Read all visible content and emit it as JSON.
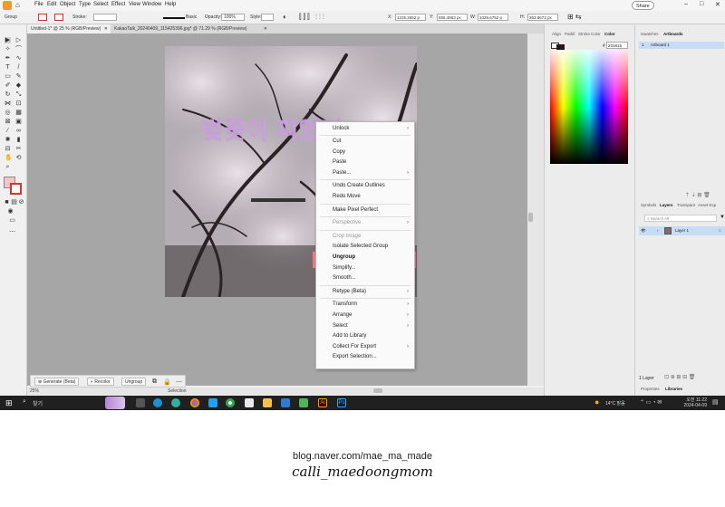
{
  "menu": [
    "File",
    "Edit",
    "Object",
    "Type",
    "Select",
    "Effect",
    "View",
    "Window",
    "Help"
  ],
  "share_button": "Share",
  "control_bar": {
    "selection_label": "Group",
    "stroke_label": "Stroke:",
    "brush_label": "Basic",
    "opacity_label": "Opacity:",
    "opacity_value": "100%",
    "style_label": "Style:",
    "x_value": "1225.2652 p",
    "y_value": "555.4863 px",
    "w_value": "1029.6752 p",
    "h_value": "353.8673 px"
  },
  "doc_tabs": [
    {
      "label": "Untitled-1* @ 25 % (RGB/Preview)",
      "active": true
    },
    {
      "label": "KakaoTalk_20240409_115425396.jpg* @ 71.29 % (RGB/Preview)",
      "active": false
    }
  ],
  "artwork": {
    "text": "벚꽃이 피었다"
  },
  "context_menu": [
    {
      "label": "Unlock",
      "arrow": true,
      "disabled": false
    },
    {
      "sep": true
    },
    {
      "label": "Cut",
      "arrow": false,
      "disabled": false
    },
    {
      "label": "Copy",
      "arrow": false,
      "disabled": false
    },
    {
      "label": "Paste",
      "arrow": false,
      "disabled": false
    },
    {
      "label": "Paste...",
      "arrow": true,
      "disabled": false
    },
    {
      "sep": true
    },
    {
      "label": "Undo Create Outlines",
      "arrow": false,
      "disabled": false
    },
    {
      "label": "Redo Move",
      "arrow": false,
      "disabled": false
    },
    {
      "sep": true
    },
    {
      "label": "Make Pixel Perfect",
      "arrow": false,
      "disabled": false
    },
    {
      "sep": true
    },
    {
      "label": "Perspective",
      "arrow": true,
      "disabled": true
    },
    {
      "sep": true
    },
    {
      "label": "Crop Image",
      "arrow": false,
      "disabled": true
    },
    {
      "label": "Isolate Selected Group",
      "arrow": false,
      "disabled": false
    },
    {
      "label": "Ungroup",
      "arrow": false,
      "disabled": false,
      "highlight": true
    },
    {
      "label": "Simplify...",
      "arrow": false,
      "disabled": false
    },
    {
      "label": "Smooth...",
      "arrow": false,
      "disabled": false
    },
    {
      "sep": true
    },
    {
      "label": "Retype (Beta)",
      "arrow": true,
      "disabled": false
    },
    {
      "sep": true
    },
    {
      "label": "Transform",
      "arrow": true,
      "disabled": false
    },
    {
      "label": "Arrange",
      "arrow": true,
      "disabled": false
    },
    {
      "label": "Select",
      "arrow": true,
      "disabled": false
    },
    {
      "label": "Add to Library",
      "arrow": false,
      "disabled": false
    },
    {
      "label": "Collect For Export",
      "arrow": true,
      "disabled": false
    },
    {
      "label": "Export Selection...",
      "arrow": false,
      "disabled": false
    }
  ],
  "bottom_toolbar": {
    "generate": "Generate (Beta)",
    "recolor": "Recolor",
    "ungroup": "Ungroup"
  },
  "status": {
    "zoom": "25%",
    "mode": "Selection"
  },
  "color_panel": {
    "tabs": [
      "Align",
      "Pathfi",
      "Stroke",
      "Color",
      "Color"
    ],
    "hex": "231815"
  },
  "right_panel": {
    "top_tabs": [
      "Swatches",
      "Artboards"
    ],
    "artboard_item": "Artboard 1",
    "mid_tabs": [
      "Symbols",
      "Layers",
      "Transpare",
      "Asset Exp"
    ],
    "search_placeholder": "Search All",
    "layer_name": "Layer 1",
    "layers_count": "1 Layer",
    "bottom_tabs": [
      "Properties",
      "Libraries"
    ]
  },
  "taskbar": {
    "search": "찾기",
    "weather": "14°C 맑음",
    "time": "오전 11:22",
    "date": "2024-04-09"
  },
  "footer": {
    "url": "blog.naver.com/mae_ma_made",
    "signature": "calli_maedoongmom"
  },
  "colors": {
    "highlight_border": "#f47a85",
    "highlight_fill": "#9cc9f6",
    "text_pink": "#e9b4e4"
  }
}
